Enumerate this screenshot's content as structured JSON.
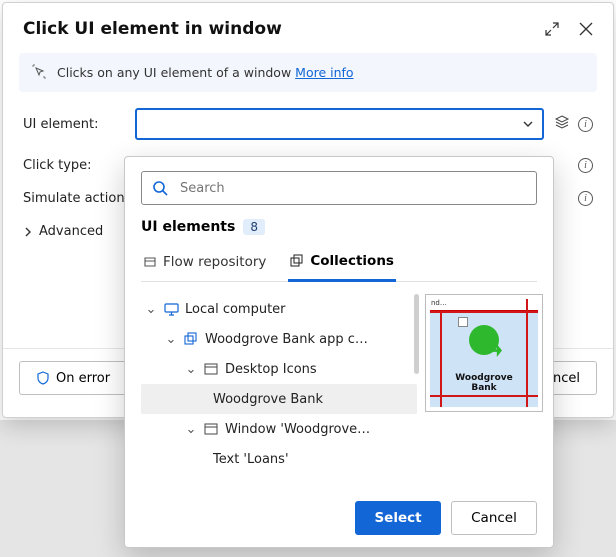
{
  "dialog": {
    "title": "Click UI element in window",
    "info_text": "Clicks on any UI element of a window ",
    "info_link": "More info"
  },
  "form": {
    "ui_element_label": "UI element:",
    "click_type_label": "Click type:",
    "simulate_label": "Simulate action:",
    "advanced_label": "Advanced"
  },
  "footer": {
    "on_error": "On error",
    "cancel": "Cancel"
  },
  "dropdown": {
    "search_placeholder": "Search",
    "subtitle": "UI elements",
    "count": "8",
    "tabs": {
      "flow": "Flow repository",
      "collections": "Collections"
    },
    "tree": {
      "local": "Local computer",
      "app": "Woodgrove Bank app c…",
      "desktop": "Desktop Icons",
      "selected": "Woodgrove Bank",
      "window": "Window 'Woodgrove…",
      "text": "Text 'Loans'"
    },
    "preview": {
      "top_text": "nd…",
      "label_l1": "Woodgrove",
      "label_l2": "Bank"
    },
    "buttons": {
      "select": "Select",
      "cancel": "Cancel"
    }
  }
}
